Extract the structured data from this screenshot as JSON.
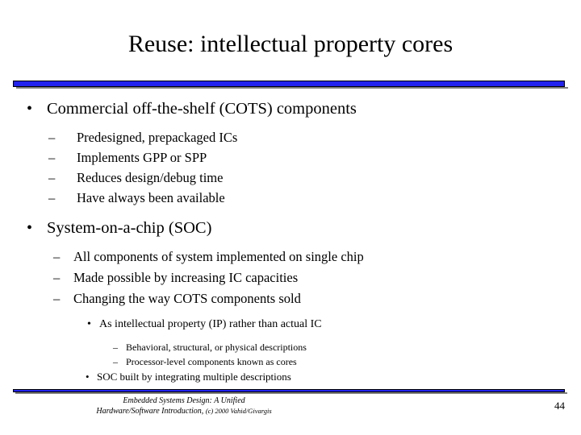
{
  "slide": {
    "title": "Reuse: intellectual property cores",
    "page_number": "44",
    "accent_color": "#2222ee",
    "bullets": {
      "b1": "Commercial off-the-shelf (COTS) components",
      "b1_subs": [
        "Predesigned, prepackaged ICs",
        "Implements GPP or SPP",
        "Reduces design/debug time",
        "Have always been available"
      ],
      "b2": "System-on-a-chip (SOC)",
      "b2_subs": [
        "All components of system implemented on single chip",
        "Made possible by increasing IC capacities",
        "Changing the way COTS components sold"
      ],
      "b2_sub3_1": "As intellectual property (IP) rather than actual IC",
      "b2_sub4": [
        "Behavioral, structural, or physical descriptions",
        "Processor-level components known as cores"
      ],
      "b2_sub3_2": "SOC built by integrating multiple descriptions"
    },
    "marks": {
      "disc": "•",
      "dash": "–"
    },
    "footer": {
      "line1": "Embedded Systems Design: A Unified",
      "line2_main": "Hardware/Software Introduction,",
      "line2_small": "(c) 2000 Vahid/Givargis"
    }
  }
}
